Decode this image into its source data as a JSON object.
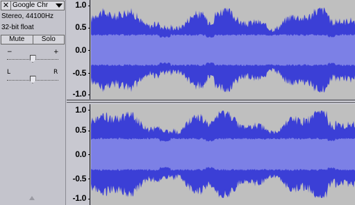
{
  "track": {
    "close_glyph": "✕",
    "name": "Google Chr",
    "format": "Stereo, 44100Hz",
    "bit_depth": "32-bit float",
    "mute_label": "Mute",
    "solo_label": "Solo",
    "gain": {
      "min_label": "−",
      "max_label": "+",
      "value": 0.5
    },
    "pan": {
      "left_label": "L",
      "right_label": "R",
      "value": 0.5
    }
  },
  "scale": {
    "channel1": [
      "1.0",
      "0.5",
      "0.0",
      "-0.5",
      "-1.0"
    ],
    "channel2": [
      "1.0",
      "0.5",
      "0.0",
      "-0.5",
      "-1.0"
    ]
  },
  "colors": {
    "waveform_peak": "#3b3fd6",
    "waveform_rms": "#7c80e6",
    "background": "#bfbfbf"
  },
  "icons": {
    "track_menu": "dropdown-arrow-icon",
    "collapse": "collapse-arrow-icon"
  }
}
